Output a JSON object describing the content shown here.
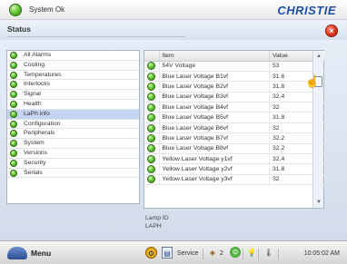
{
  "header": {
    "system_status": "System Ok",
    "brand": "CHRISTIE"
  },
  "panel": {
    "title": "Status"
  },
  "nav": {
    "items": [
      {
        "label": "All Alarms",
        "selected": false
      },
      {
        "label": "Cooling",
        "selected": false
      },
      {
        "label": "Temperatures",
        "selected": false
      },
      {
        "label": "Interlocks",
        "selected": false
      },
      {
        "label": "Signal",
        "selected": false
      },
      {
        "label": "Health",
        "selected": false
      },
      {
        "label": "LaPh info",
        "selected": true
      },
      {
        "label": "Configuration",
        "selected": false
      },
      {
        "label": "Peripherals",
        "selected": false
      },
      {
        "label": "System",
        "selected": false
      },
      {
        "label": "Versions",
        "selected": false
      },
      {
        "label": "Security",
        "selected": false
      },
      {
        "label": "Serials",
        "selected": false
      }
    ]
  },
  "table": {
    "headers": {
      "item": "Item",
      "value": "Value"
    },
    "rows": [
      {
        "item": "54V Voltage",
        "value": "53"
      },
      {
        "item": "Blue Laser Voltage B1vf",
        "value": "31.6"
      },
      {
        "item": "Blue Laser Voltage B2vf",
        "value": "31.8"
      },
      {
        "item": "Blue Laser Voltage B3vf",
        "value": "32.4"
      },
      {
        "item": "Blue Laser Voltage B4vf",
        "value": "32"
      },
      {
        "item": "Blue Laser Voltage B5vf",
        "value": "31.8"
      },
      {
        "item": "Blue Laser Voltage B6vf",
        "value": "32"
      },
      {
        "item": "Blue Laser Voltage B7vf",
        "value": "32.2"
      },
      {
        "item": "Blue Laser Voltage B8vf",
        "value": "32.2"
      },
      {
        "item": "Yellow Laser Voltage y1vf",
        "value": "32.4"
      },
      {
        "item": "Yellow Laser Voltage y2vf",
        "value": "31.8"
      },
      {
        "item": "Yellow Laser Voltage y3vf",
        "value": "32"
      }
    ]
  },
  "lamp": {
    "line1": "Lamp ID",
    "line2": "LAPH"
  },
  "taskbar": {
    "menu_label": "Menu",
    "service_label": "Service",
    "count": "2",
    "time": "10:05:02 AM"
  },
  "colors": {
    "ok_led": "#5cc234",
    "selected_row": "#c5d5f0",
    "close": "#e23c24",
    "brand": "#1e4fa3"
  },
  "icons": {
    "status": "green-led-icon",
    "close": "close-x-icon",
    "menu": "menu-icon",
    "warning": "warning-icon",
    "screen": "screen-icon",
    "cube": "cube-icon",
    "power": "power-icon",
    "bulb": "bulb-icon",
    "temperature": "temperature-icon",
    "cursor": "hand-pointer-icon"
  }
}
